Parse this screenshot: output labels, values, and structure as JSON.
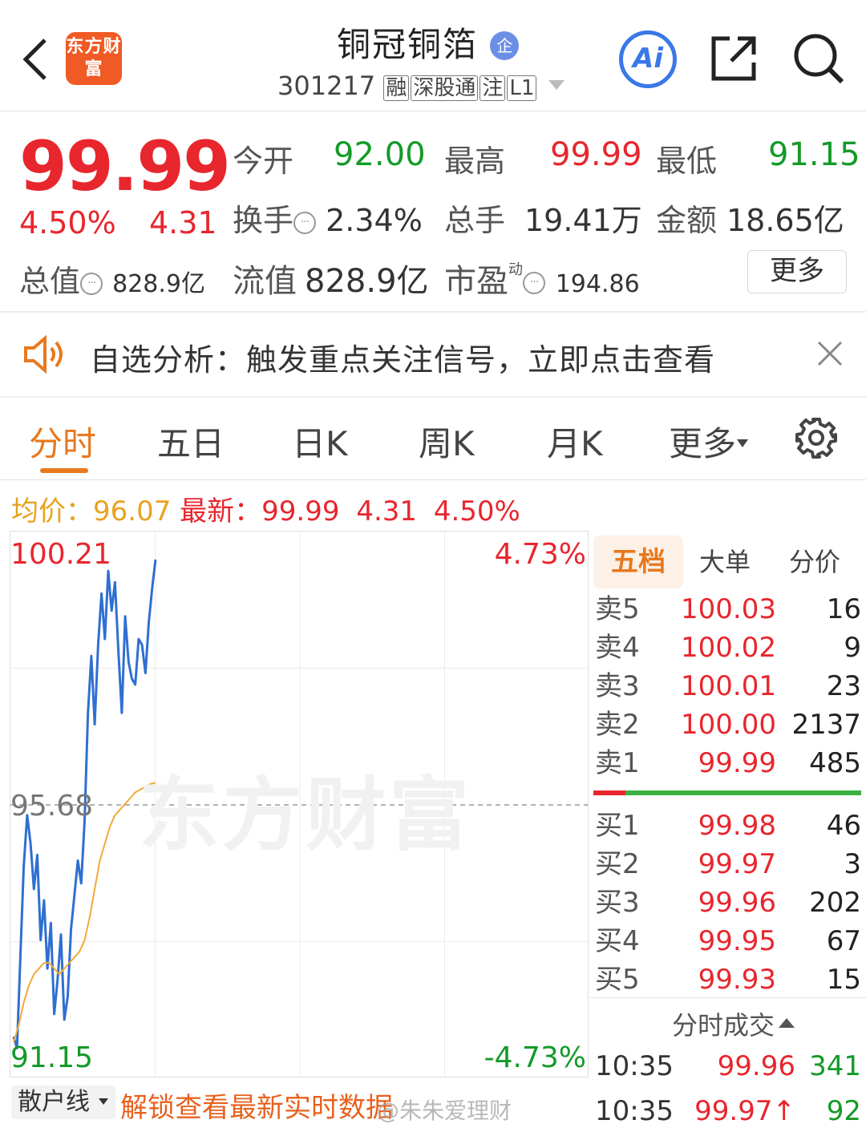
{
  "header": {
    "app_logo": "东方财富",
    "stock_name": "铜冠铜箔",
    "enterprise_badge": "企",
    "stock_code": "301217",
    "tags": [
      "融",
      "深股通",
      "注",
      "L1"
    ],
    "ai_label": "Ai"
  },
  "quote": {
    "price": "99.99",
    "change_pct": "4.50%",
    "change": "4.31",
    "open_label": "今开",
    "open": "92.00",
    "high_label": "最高",
    "high": "99.99",
    "low_label": "最低",
    "low": "91.15",
    "turnover_label": "换手",
    "turnover": "2.34%",
    "volume_label": "总手",
    "volume": "19.41万",
    "amount_label": "金额",
    "amount": "18.65亿",
    "mktcap_label": "总值",
    "mktcap": "828.9亿",
    "float_label": "流值",
    "float": "828.9亿",
    "pe_label": "市盈",
    "pe_sup": "动",
    "pe": "194.86",
    "more_button": "更多"
  },
  "banner": {
    "text": "自选分析：触发重点关注信号，立即点击查看"
  },
  "tabs": [
    "分时",
    "五日",
    "日K",
    "周K",
    "月K",
    "更多"
  ],
  "summary": {
    "avg_label": "均价：",
    "avg": "96.07",
    "latest_label": "最新：",
    "latest": "99.99",
    "change": "4.31",
    "change_pct": "4.50%"
  },
  "chart_labels": {
    "y_max": "100.21",
    "y_mid": "95.68",
    "y_min": "91.15",
    "pct_max": "4.73%",
    "pct_min": "-4.73%",
    "watermark": "东方财富"
  },
  "chart_data": {
    "type": "line",
    "ylim": [
      91.15,
      100.21
    ],
    "reference": 95.68,
    "series": [
      {
        "values": [
          91.6,
          91.4,
          93.0,
          94.6,
          95.5,
          95.0,
          94.2,
          94.8,
          93.3,
          94.0,
          92.8,
          93.6,
          92.0,
          92.6,
          93.4,
          91.9,
          92.3,
          93.5,
          94.1,
          94.7,
          94.3,
          95.4,
          97.3,
          98.3,
          97.1,
          98.5,
          99.4,
          98.6,
          99.8,
          99.1,
          99.6,
          98.4,
          97.3,
          99.0,
          98.2,
          97.9,
          97.8,
          98.6,
          98.5,
          98.0,
          98.9,
          99.5,
          100.0
        ]
      },
      {
        "values": [
          91.5,
          91.8,
          92.2,
          92.5,
          92.7,
          92.8,
          92.9,
          92.9,
          92.8,
          92.7,
          92.8,
          92.9,
          93.0,
          93.1,
          93.3,
          93.7,
          94.2,
          94.7,
          95.0,
          95.3,
          95.5,
          95.6,
          95.7,
          95.8,
          95.9,
          95.95,
          96.0,
          96.05,
          96.07
        ]
      }
    ]
  },
  "order_book_tabs": [
    "五档",
    "大单",
    "分价"
  ],
  "order_book": {
    "asks": [
      {
        "label": "卖5",
        "price": "100.03",
        "vol": "16"
      },
      {
        "label": "卖4",
        "price": "100.02",
        "vol": "9"
      },
      {
        "label": "卖3",
        "price": "100.01",
        "vol": "23"
      },
      {
        "label": "卖2",
        "price": "100.00",
        "vol": "2137"
      },
      {
        "label": "卖1",
        "price": "99.99",
        "vol": "485"
      }
    ],
    "bids": [
      {
        "label": "买1",
        "price": "99.98",
        "vol": "46"
      },
      {
        "label": "买2",
        "price": "99.97",
        "vol": "3"
      },
      {
        "label": "买3",
        "price": "99.96",
        "vol": "202"
      },
      {
        "label": "买4",
        "price": "99.95",
        "vol": "67"
      },
      {
        "label": "买5",
        "price": "99.93",
        "vol": "15"
      }
    ],
    "ratio": 0.12
  },
  "trades_title": "分时成交",
  "trades": [
    {
      "time": "10:35",
      "price": "99.96",
      "vol": "341",
      "arrow": ""
    },
    {
      "time": "10:35",
      "price": "99.97",
      "vol": "92",
      "arrow": "↑"
    }
  ],
  "bottom": {
    "retail_line": "散户线",
    "unlock_text": "解锁查看最新实时数据",
    "watermark": "@朱朱爱理财"
  }
}
